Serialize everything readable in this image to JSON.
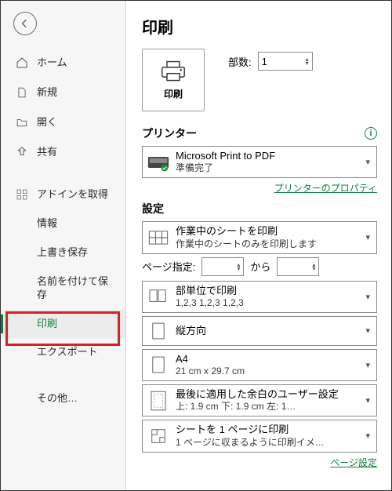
{
  "sidebar": {
    "items": [
      {
        "label": "ホーム"
      },
      {
        "label": "新規"
      },
      {
        "label": "開く"
      },
      {
        "label": "共有"
      },
      {
        "label": "アドインを取得"
      },
      {
        "label": "情報"
      },
      {
        "label": "上書き保存"
      },
      {
        "label": "名前を付けて保存"
      },
      {
        "label": "印刷"
      },
      {
        "label": "エクスポート"
      },
      {
        "label": "その他…"
      }
    ]
  },
  "page": {
    "title": "印刷",
    "print_button": "印刷",
    "copies_label": "部数:",
    "copies_value": "1"
  },
  "printer": {
    "section": "プリンター",
    "name": "Microsoft Print to PDF",
    "status": "準備完了",
    "properties_link": "プリンターのプロパティ"
  },
  "settings": {
    "section": "設定",
    "scope_title": "作業中のシートを印刷",
    "scope_sub": "作業中のシートのみを印刷します",
    "page_label": "ページ指定:",
    "page_from": "",
    "page_to_label": "から",
    "page_to": "",
    "collate_title": "部単位で印刷",
    "collate_sub": "1,2,3    1,2,3    1,2,3",
    "orientation_title": "縦方向",
    "paper_title": "A4",
    "paper_sub": "21 cm x 29.7 cm",
    "margins_title": "最後に適用した余白のユーザー設定",
    "margins_sub": "上: 1.9 cm 下: 1.9 cm 左: 1…",
    "scaling_title": "シートを 1 ページに印刷",
    "scaling_sub": "1 ページに収まるように印刷イメ…",
    "page_setup_link": "ページ設定"
  }
}
